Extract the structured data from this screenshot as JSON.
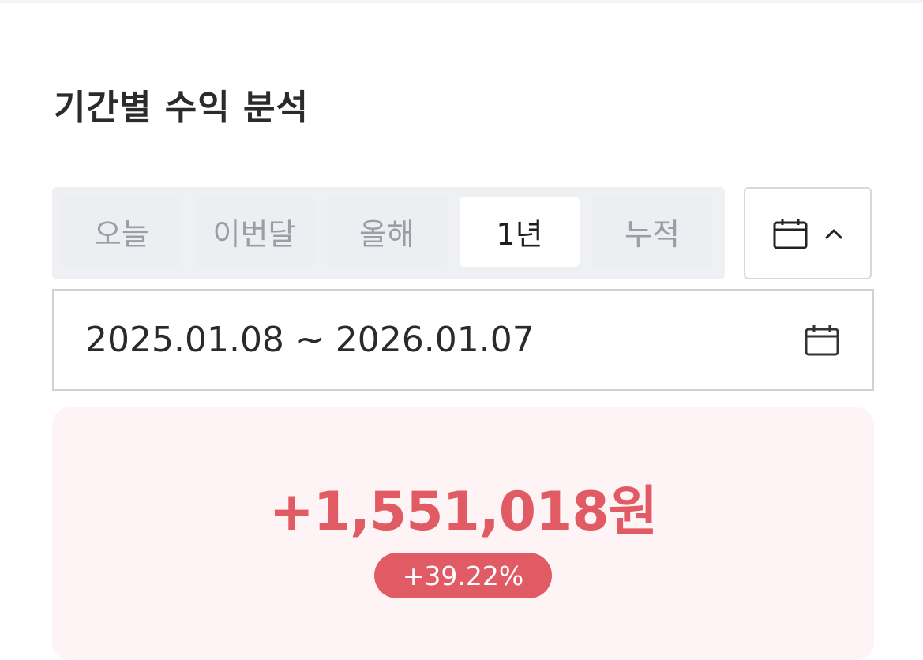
{
  "title": "기간별 수익 분석",
  "period_tabs": [
    {
      "label": "오늘",
      "active": false
    },
    {
      "label": "이번달",
      "active": false
    },
    {
      "label": "올해",
      "active": false
    },
    {
      "label": "1년",
      "active": true
    },
    {
      "label": "누적",
      "active": false
    }
  ],
  "calendar_toggle": {
    "icon": "calendar-icon",
    "chevron": "chevron-up-icon"
  },
  "date_range": {
    "text": "2025.01.08 ~ 2026.01.07",
    "icon": "calendar-icon"
  },
  "profit": {
    "amount": "+1,551,018원",
    "rate": "+39.22%",
    "accent_color": "#e05b63",
    "card_bg": "#fff4f5"
  }
}
